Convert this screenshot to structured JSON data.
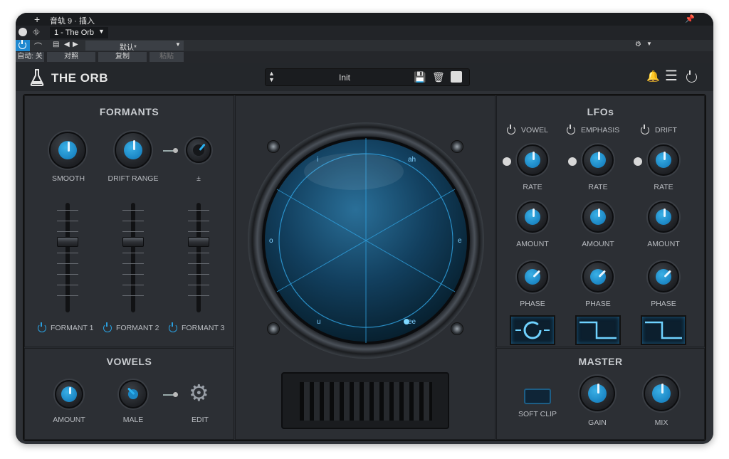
{
  "host": {
    "track_title": "音轨 9 · 插入",
    "preset_slot": "1 - The Orb",
    "preset_default": "默认*",
    "auto_label": "自动: 关",
    "compare_label": "对照",
    "copy_label": "复制",
    "paste_label": "粘贴"
  },
  "plugin": {
    "name": "THE ORB",
    "preset_name": "Init"
  },
  "formants": {
    "title": "FORMANTS",
    "smooth_label": "SMOOTH",
    "drift_range_label": "DRIFT RANGE",
    "plusminus_label": "±",
    "faders": [
      {
        "label": "FORMANT 1"
      },
      {
        "label": "FORMANT 2"
      },
      {
        "label": "FORMANT 3"
      }
    ]
  },
  "vowels": {
    "title": "VOWELS",
    "amount_label": "AMOUNT",
    "male_label": "MALE",
    "edit_label": "EDIT"
  },
  "orb": {
    "labels": [
      "i",
      "ah",
      "o",
      "e",
      "u",
      "ee"
    ]
  },
  "lfos": {
    "title": "LFOs",
    "columns": [
      {
        "name": "VOWEL",
        "rate": "RATE",
        "amount": "AMOUNT",
        "phase": "PHASE"
      },
      {
        "name": "EMPHASIS",
        "rate": "RATE",
        "amount": "AMOUNT",
        "phase": "PHASE"
      },
      {
        "name": "DRIFT",
        "rate": "RATE",
        "amount": "AMOUNT",
        "phase": "PHASE"
      }
    ]
  },
  "master": {
    "title": "MASTER",
    "soft_clip_label": "SOFT CLIP",
    "gain_label": "GAIN",
    "mix_label": "MIX"
  },
  "colors": {
    "accent": "#1e90d0",
    "panel": "#2c2f34",
    "text": "#b9bcc1"
  }
}
